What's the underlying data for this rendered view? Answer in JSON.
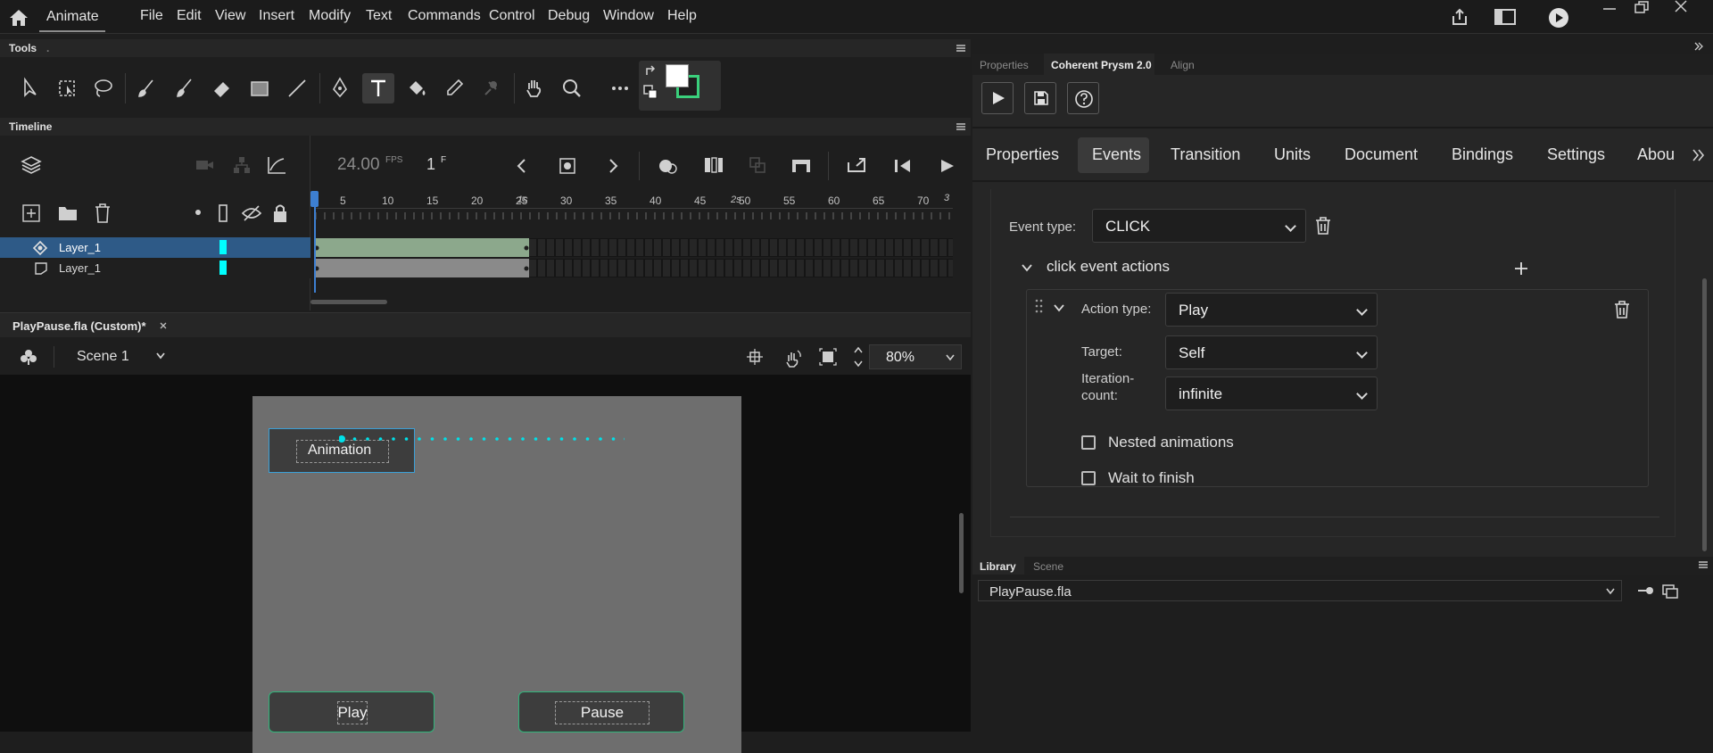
{
  "app": {
    "name": "Animate"
  },
  "menu": [
    "File",
    "Edit",
    "View",
    "Insert",
    "Modify",
    "Text",
    "Commands",
    "Control",
    "Debug",
    "Window",
    "Help"
  ],
  "panels": {
    "tools_title": "Tools",
    "timeline_title": "Timeline"
  },
  "timeline": {
    "fps_value": "24.00",
    "fps_unit": "FPS",
    "frame_value": "1",
    "frame_unit": "F",
    "layers": [
      {
        "name": "Layer_1",
        "selected": true
      },
      {
        "name": "Layer_1",
        "selected": false
      }
    ],
    "ruler_numbers": [
      "5",
      "10",
      "15",
      "20",
      "25",
      "30",
      "35",
      "40",
      "45",
      "50",
      "55",
      "60",
      "65",
      "70"
    ],
    "seconds_markers": [
      "1s",
      "2s",
      "3"
    ],
    "layer_color": "#00ffff",
    "selected_row_color": "#2e5a87"
  },
  "document": {
    "tab_label": "PlayPause.fla (Custom)*",
    "scene_label": "Scene 1",
    "zoom": "80%"
  },
  "stage": {
    "animation_label": "Animation",
    "play_label": "Play",
    "pause_label": "Pause",
    "stage_color": "#6e6e6e",
    "button_border_color": "#2fb57a"
  },
  "right_panel": {
    "top_tabs": [
      "Properties",
      "Coherent Prysm 2.0",
      "Align"
    ],
    "active_top_tab": "Coherent Prysm 2.0",
    "sub_tabs": [
      "Properties",
      "Events",
      "Transition",
      "Units",
      "Document",
      "Bindings",
      "Settings",
      "Abou"
    ],
    "active_sub_tab": "Events",
    "event_type_label": "Event type:",
    "event_type_value": "CLICK",
    "actions_header": "click event actions",
    "action_type_label": "Action type:",
    "action_type_value": "Play",
    "target_label": "Target:",
    "target_value": "Self",
    "iteration_label_1": "Iteration-",
    "iteration_label_2": "count:",
    "iteration_value": "infinite",
    "nested_label": "Nested animations",
    "wait_label": "Wait to finish"
  },
  "library": {
    "tabs": [
      "Library",
      "Scene"
    ],
    "active_tab": "Library",
    "file": "PlayPause.fla"
  },
  "icons": [
    "home-icon",
    "share-icon",
    "screen-mode-icon",
    "test-movie-icon",
    "minimize-icon",
    "restore-icon",
    "close-icon"
  ]
}
